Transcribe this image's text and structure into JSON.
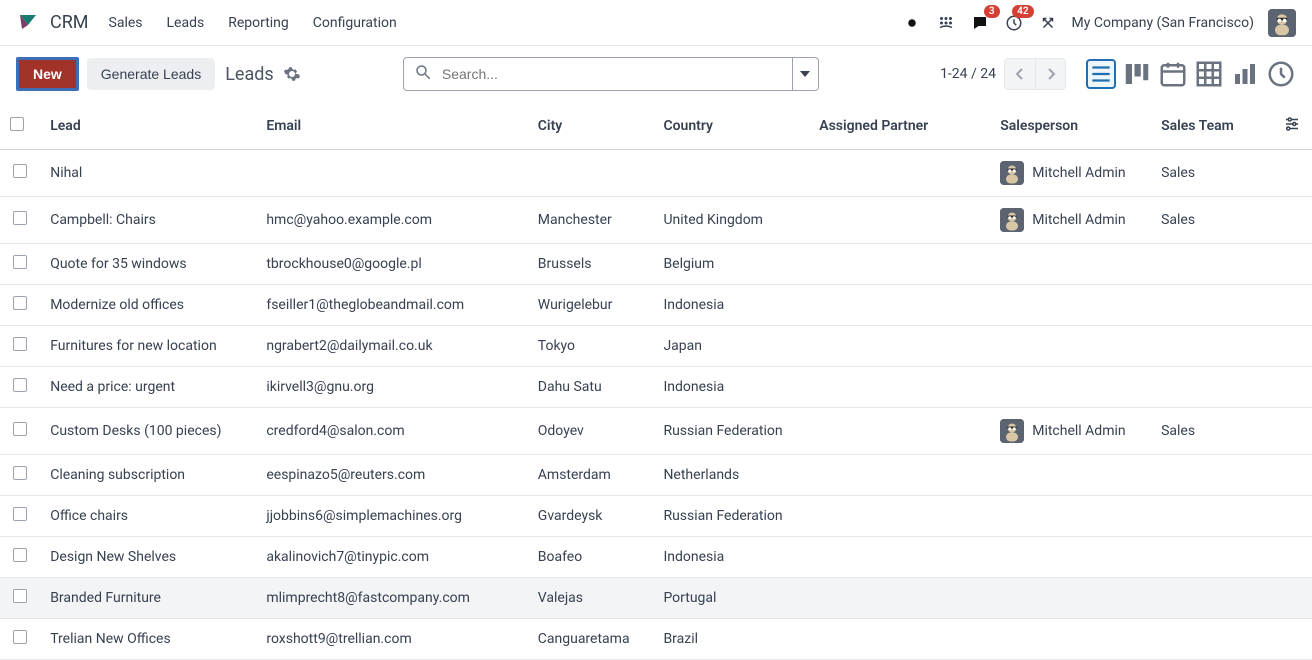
{
  "app": {
    "name": "CRM"
  },
  "menu": {
    "items": [
      "Sales",
      "Leads",
      "Reporting",
      "Configuration"
    ]
  },
  "topbar": {
    "company": "My Company (San Francisco)",
    "messages_badge": "3",
    "activities_badge": "42"
  },
  "controls": {
    "new_label": "New",
    "generate_label": "Generate Leads",
    "breadcrumb": "Leads",
    "search_placeholder": "Search...",
    "pager": "1-24 / 24"
  },
  "columns": {
    "lead": "Lead",
    "email": "Email",
    "city": "City",
    "country": "Country",
    "partner": "Assigned Partner",
    "salesperson": "Salesperson",
    "team": "Sales Team"
  },
  "rows": [
    {
      "lead": "Nihal",
      "email": "",
      "city": "",
      "country": "",
      "partner": "",
      "salesperson": "Mitchell Admin",
      "team": "Sales"
    },
    {
      "lead": "Campbell: Chairs",
      "email": "hmc@yahoo.example.com",
      "city": "Manchester",
      "country": "United Kingdom",
      "partner": "",
      "salesperson": "Mitchell Admin",
      "team": "Sales"
    },
    {
      "lead": "Quote for 35 windows",
      "email": "tbrockhouse0@google.pl",
      "city": "Brussels",
      "country": "Belgium",
      "partner": "",
      "salesperson": "",
      "team": ""
    },
    {
      "lead": "Modernize old offices",
      "email": "fseiller1@theglobeandmail.com",
      "city": "Wurigelebur",
      "country": "Indonesia",
      "partner": "",
      "salesperson": "",
      "team": ""
    },
    {
      "lead": "Furnitures for new location",
      "email": "ngrabert2@dailymail.co.uk",
      "city": "Tokyo",
      "country": "Japan",
      "partner": "",
      "salesperson": "",
      "team": ""
    },
    {
      "lead": "Need a price: urgent",
      "email": "ikirvell3@gnu.org",
      "city": "Dahu Satu",
      "country": "Indonesia",
      "partner": "",
      "salesperson": "",
      "team": ""
    },
    {
      "lead": "Custom Desks (100 pieces)",
      "email": "credford4@salon.com",
      "city": "Odoyev",
      "country": "Russian Federation",
      "partner": "",
      "salesperson": "Mitchell Admin",
      "team": "Sales"
    },
    {
      "lead": "Cleaning subscription",
      "email": "eespinazo5@reuters.com",
      "city": "Amsterdam",
      "country": "Netherlands",
      "partner": "",
      "salesperson": "",
      "team": ""
    },
    {
      "lead": "Office chairs",
      "email": "jjobbins6@simplemachines.org",
      "city": "Gvardeysk",
      "country": "Russian Federation",
      "partner": "",
      "salesperson": "",
      "team": ""
    },
    {
      "lead": "Design New Shelves",
      "email": "akalinovich7@tinypic.com",
      "city": "Boafeo",
      "country": "Indonesia",
      "partner": "",
      "salesperson": "",
      "team": ""
    },
    {
      "lead": "Branded Furniture",
      "email": "mlimprecht8@fastcompany.com",
      "city": "Valejas",
      "country": "Portugal",
      "partner": "",
      "salesperson": "",
      "team": ""
    },
    {
      "lead": "Trelian New Offices",
      "email": "roxshott9@trellian.com",
      "city": "Canguaretama",
      "country": "Brazil",
      "partner": "",
      "salesperson": "",
      "team": ""
    }
  ]
}
